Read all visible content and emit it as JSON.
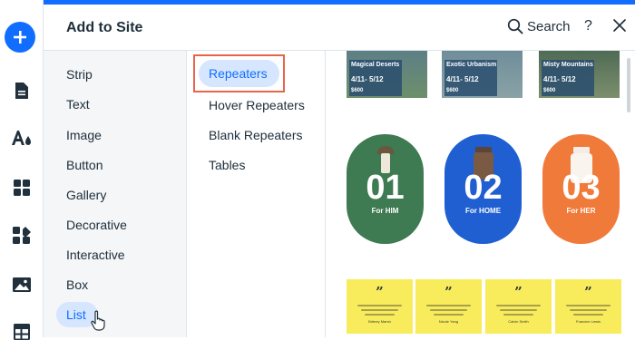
{
  "header": {
    "title": "Add to Site",
    "search_label": "Search",
    "help_label": "?"
  },
  "rail": {
    "icons": [
      "add-icon",
      "page-icon",
      "theme-icon",
      "apps-icon",
      "extensions-icon",
      "media-icon",
      "table-icon"
    ]
  },
  "categories": {
    "items": [
      "Strip",
      "Text",
      "Image",
      "Button",
      "Gallery",
      "Decorative",
      "Interactive",
      "Box",
      "List"
    ],
    "selected": "List"
  },
  "subcategories": {
    "items": [
      "Repeaters",
      "Hover Repeaters",
      "Blank Repeaters",
      "Tables"
    ],
    "selected": "Repeaters"
  },
  "preview": {
    "travel_cards": [
      {
        "name": "Magical Deserts",
        "dates": "4/11- 5/12",
        "price": "$600"
      },
      {
        "name": "Exotic Urbanism",
        "dates": "4/11- 5/12",
        "price": "$600"
      },
      {
        "name": "Misty Mountains",
        "dates": "4/11- 5/12",
        "price": "$600"
      }
    ],
    "product_cards": [
      {
        "number": "01",
        "label": "For HIM",
        "color": "#3e7a52"
      },
      {
        "number": "02",
        "label": "For HOME",
        "color": "#1f5fd1"
      },
      {
        "number": "03",
        "label": "For HER",
        "color": "#f07a3a"
      }
    ],
    "quote_cards": [
      {
        "mark": "”",
        "name": "Britney Marsh"
      },
      {
        "mark": "”",
        "name": "Nicole Yang"
      },
      {
        "mark": "”",
        "name": "Calvin Smith"
      },
      {
        "mark": "”",
        "name": "Francine Lewis"
      }
    ]
  },
  "colors": {
    "accent": "#116dff",
    "selection_bg": "#d6e6fe",
    "highlight_border": "#e8644a",
    "panel_bg": "#f4f6f8"
  }
}
